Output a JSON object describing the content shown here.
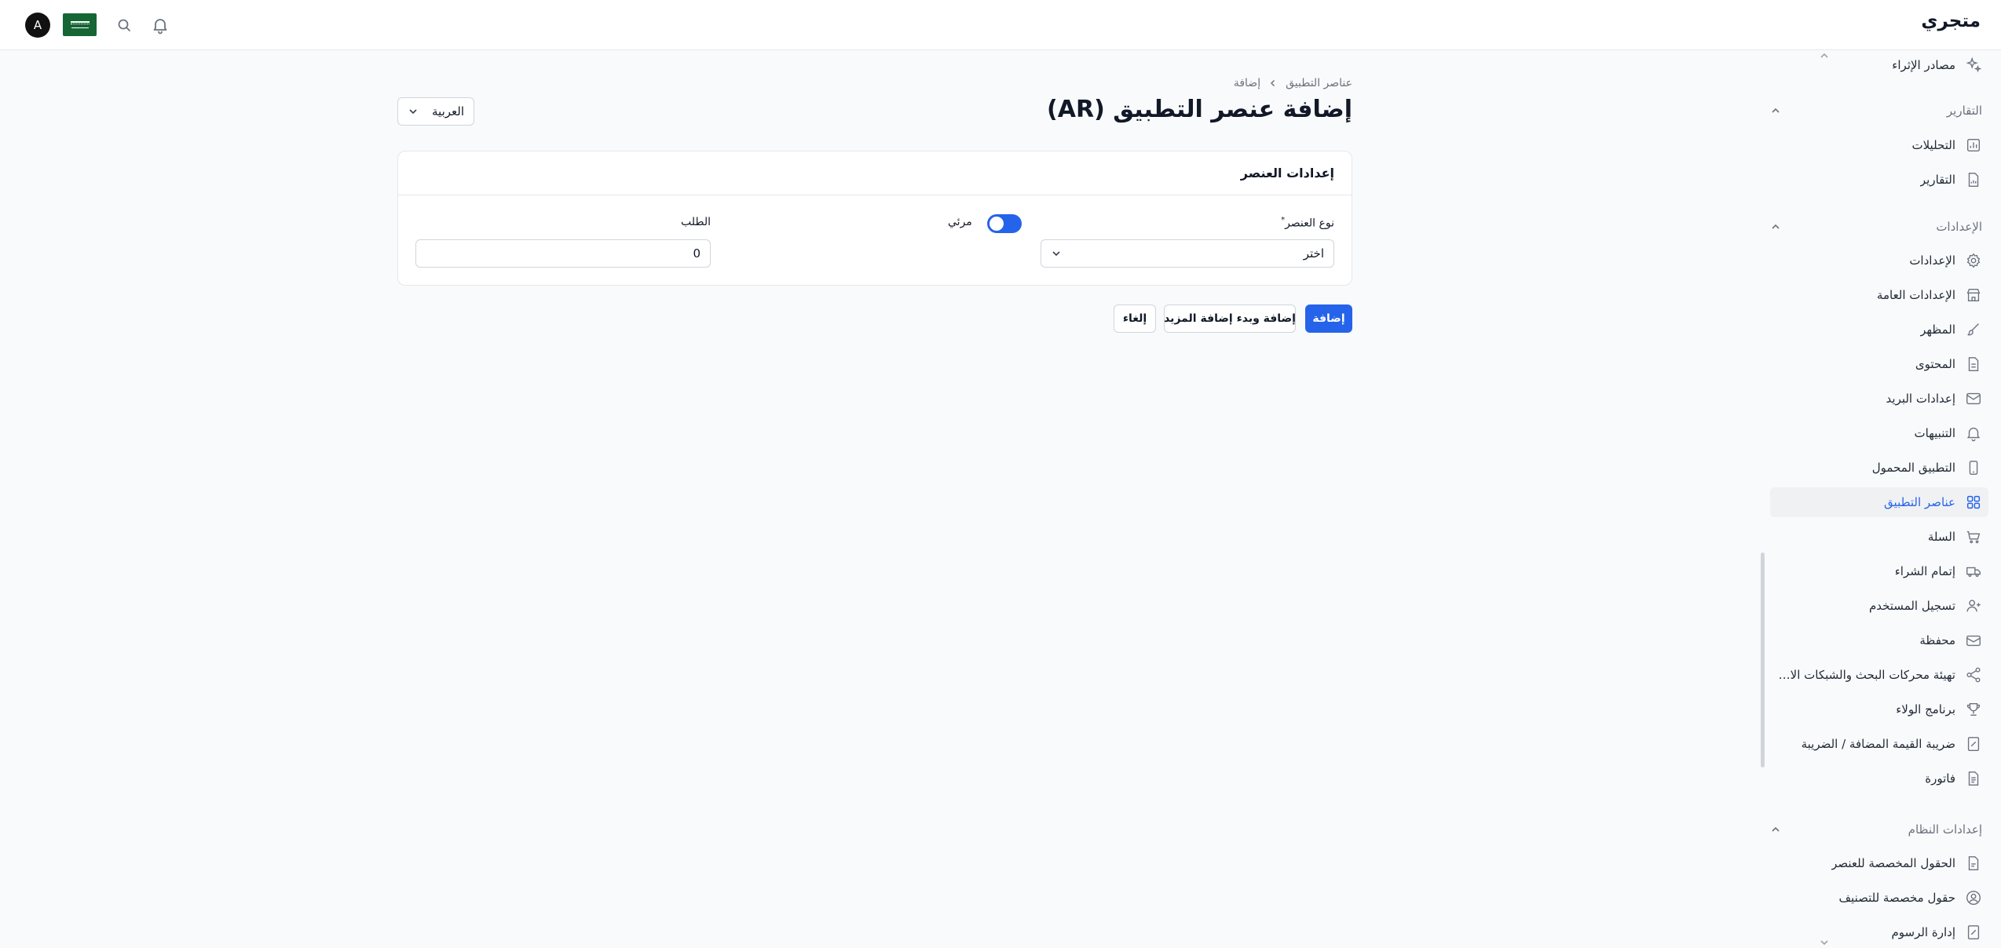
{
  "header": {
    "brand": "متجري",
    "avatar_initial": "A",
    "icons": [
      "bell-icon",
      "search-icon",
      "flag-icon"
    ]
  },
  "sidebar": {
    "items_top": [
      {
        "label": "مصادر الإثراء",
        "icon": "sparkles-icon"
      }
    ],
    "sections": [
      {
        "title": "التقارير",
        "items": [
          {
            "label": "التحليلات",
            "icon": "chart-icon"
          },
          {
            "label": "التقارير",
            "icon": "report-file-icon"
          }
        ]
      },
      {
        "title": "الإعدادات",
        "items": [
          {
            "label": "الإعدادات",
            "icon": "gear-icon"
          },
          {
            "label": "الإعدادات العامة",
            "icon": "store-icon"
          },
          {
            "label": "المظهر",
            "icon": "brush-icon"
          },
          {
            "label": "المحتوى",
            "icon": "document-icon"
          },
          {
            "label": "إعدادات البريد",
            "icon": "mail-icon"
          },
          {
            "label": "التنبيهات",
            "icon": "bell-icon"
          },
          {
            "label": "التطبيق المحمول",
            "icon": "mobile-icon"
          },
          {
            "label": "عناصر التطبيق",
            "icon": "grid-icon",
            "active": true
          },
          {
            "label": "السلة",
            "icon": "cart-icon"
          },
          {
            "label": "إتمام الشراء",
            "icon": "truck-icon"
          },
          {
            "label": "تسجيل المستخدم",
            "icon": "user-plus-icon"
          },
          {
            "label": "محفظة",
            "icon": "wallet-icon"
          },
          {
            "label": "تهيئة محركات البحث والشبكات الاجتماعية",
            "icon": "share-icon"
          },
          {
            "label": "برنامج الولاء",
            "icon": "trophy-icon"
          },
          {
            "label": "ضريبة القيمة المضافة / الضريبة",
            "icon": "tax-icon"
          },
          {
            "label": "فاتورة",
            "icon": "invoice-icon"
          }
        ]
      },
      {
        "title": "إعدادات النظام",
        "items": [
          {
            "label": "الحقول المخصصة للعنصر",
            "icon": "custom-field-icon"
          },
          {
            "label": "حقول مخصصة للتصنيف",
            "icon": "user-circle-icon"
          },
          {
            "label": "إدارة الرسوم",
            "icon": "fees-icon"
          }
        ]
      }
    ]
  },
  "main": {
    "breadcrumb": {
      "parent": "عناصر التطبيق",
      "current": "إضافة"
    },
    "title": "إضافة عنصر التطبيق (AR)",
    "language_select": "العربية",
    "card": {
      "title": "إعدادات العنصر",
      "type_label": "نوع العنصر",
      "required_mark": "*",
      "type_value": "اختر",
      "visible_label": "مرئي",
      "visible_on": true,
      "order_label": "الطلب",
      "order_value": "0"
    },
    "buttons": {
      "add": "إضافة",
      "add_more": "إضافة وبدء إضافة المزيد",
      "cancel": "إلغاء"
    }
  },
  "colors": {
    "accent": "#2563eb",
    "background": "#f9fafb",
    "card": "#ffffff",
    "border": "#e5e7eb"
  }
}
